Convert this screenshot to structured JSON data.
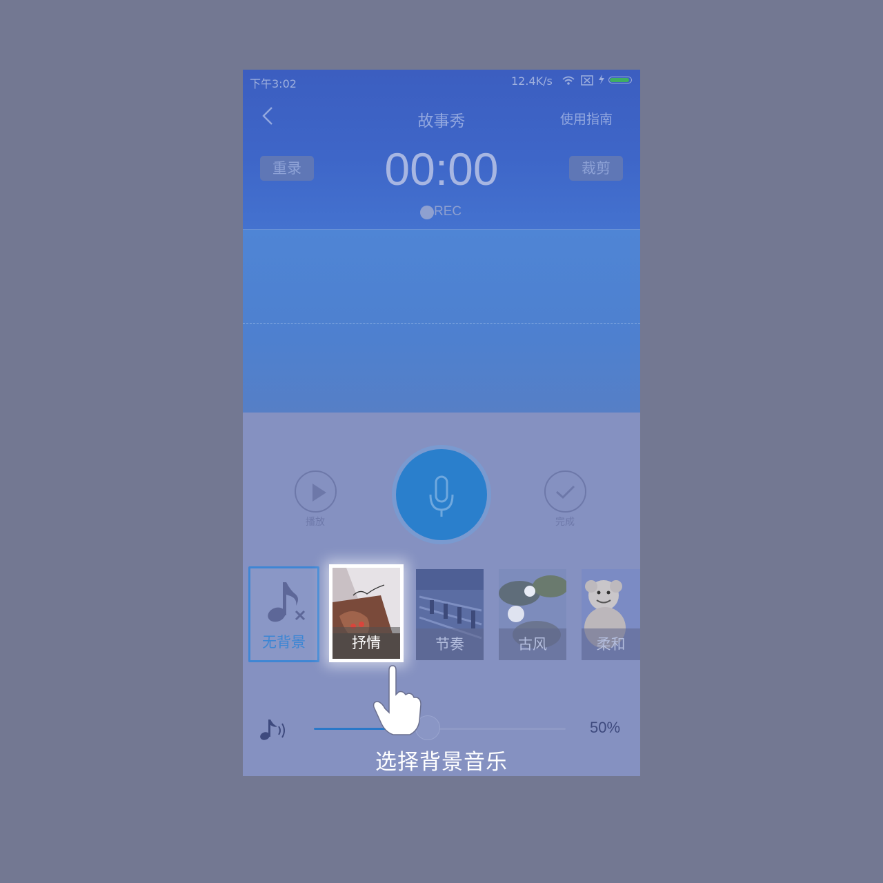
{
  "status_bar": {
    "time": "下午3:02",
    "network_speed": "12.4K/s",
    "battery_color": "#3fae63"
  },
  "header": {
    "back_icon": "chevron-left-icon",
    "title": "故事秀",
    "guide_link": "使用指南"
  },
  "recorder": {
    "rerecord_label": "重录",
    "timer": "00:00",
    "rec_label": "REC",
    "trim_label": "裁剪"
  },
  "controls": {
    "play_label": "播放",
    "mic_icon": "microphone-icon",
    "done_label": "完成",
    "accent_color": "#2a7fcc"
  },
  "background_music": {
    "items": [
      {
        "label": "无背景",
        "icon": "music-note-mute-icon",
        "selected": false
      },
      {
        "label": "抒情",
        "selected": true
      },
      {
        "label": "节奏",
        "selected": false
      },
      {
        "label": "古风",
        "selected": false
      },
      {
        "label": "柔和",
        "selected": false
      }
    ]
  },
  "volume": {
    "icon": "music-volume-icon",
    "value_label": "50%",
    "value": 0.5
  },
  "hint": {
    "text": "选择背景音乐"
  }
}
